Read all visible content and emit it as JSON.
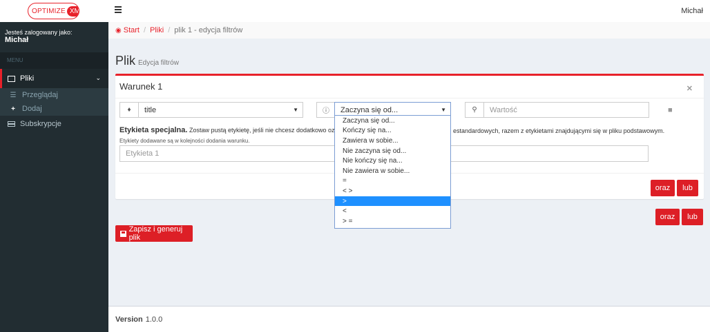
{
  "header": {
    "logo_text": "OPTIMIZE",
    "logo_badge": "XML",
    "user": "Michał"
  },
  "sidebar": {
    "logged_in_label": "Jesteś zalogowany jako:",
    "logged_in_user": "Michał",
    "menu_header": "MENU",
    "items": [
      {
        "label": "Pliki",
        "icon": "image-icon",
        "expanded": true
      },
      {
        "label": "Subskrypcje",
        "icon": "credit-card-icon"
      }
    ],
    "subitems": [
      {
        "label": "Przeglądaj",
        "icon": "list-icon"
      },
      {
        "label": "Dodaj",
        "icon": "plus-icon"
      }
    ]
  },
  "breadcrumb": {
    "start": "Start",
    "pliki": "Pliki",
    "current": "plik 1 - edycja filtrów"
  },
  "page": {
    "title": "Plik",
    "subtitle": "Edycja filtrów"
  },
  "condition": {
    "title": "Warunek 1",
    "field_value": "title",
    "operator_value": "Zaczyna się od...",
    "value_placeholder": "Wartość",
    "special_label_bold": "Etykieta specjalna.",
    "special_label_text": " Zostaw pustą etykietę, jeśli nie chcesz dodatkowo oznaczać prod",
    "special_label_text_right": "estandardowych, razem z etykietami znajdującymi się w pliku podstawowym.",
    "help_text": "Etykiety dodawane są w kolejności dodania warunku.",
    "label_placeholder": "Etykieta 1",
    "btn_oraz": "oraz",
    "btn_lub": "lub"
  },
  "operators": [
    "Zaczyna się od...",
    "Kończy się na...",
    "Zawiera w sobie...",
    "Nie zaczyna się od...",
    "Nie kończy się na...",
    "Nie zawiera w sobie...",
    "=",
    "< >",
    ">",
    "<",
    "> =",
    "< ="
  ],
  "operators_selected_index": 8,
  "outer_buttons": {
    "oraz": "oraz",
    "lub": "lub"
  },
  "save_button": "Zapisz i generuj plik",
  "footer": {
    "version_label": "Version",
    "version": "1.0.0"
  }
}
